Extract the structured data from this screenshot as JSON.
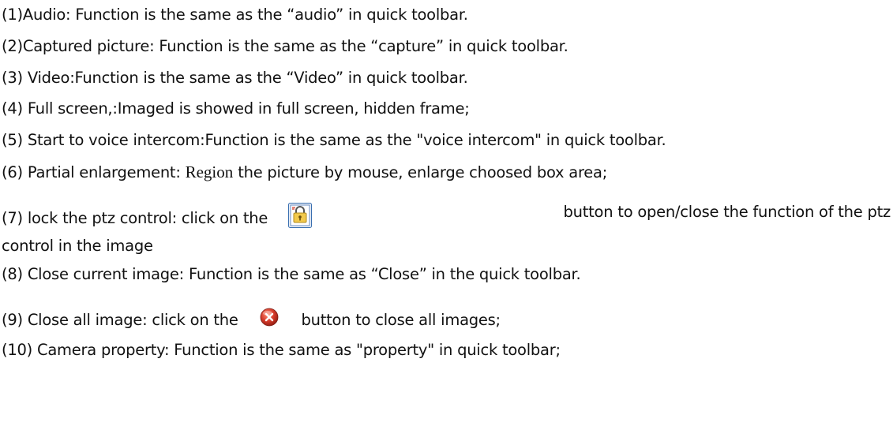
{
  "items": [
    {
      "text": "(1)Audio: Function is the same as the “audio” in quick toolbar."
    },
    {
      "text": "(2)Captured picture: Function is the same as the “capture” in quick toolbar."
    },
    {
      "text": "(3) Video:Function is the same as the “Video” in quick toolbar."
    },
    {
      "text": "(4) Full screen,:Imaged is showed in full screen, hidden frame;"
    },
    {
      "text": "(5) Start to voice intercom:Function is the same as the \"voice intercom\" in quick toolbar."
    },
    {
      "before": "(6) Partial enlargement: ",
      "serif_word": "Region",
      "after": " the picture by mouse, enlarge choosed box area;"
    },
    {
      "before": "(7) lock the ptz control: click on the",
      "after": "button to open/close the function of the ptz",
      "continuation": "control in the image",
      "icon": "lock-icon"
    },
    {
      "text": "(8) Close current image: Function is the same as “Close” in the quick toolbar."
    },
    {
      "before": "(9) Close all image: click on the",
      "after": "button to close all images;",
      "icon": "close-icon"
    },
    {
      "text": "(10) Camera property: Function is the same as \"property\" in quick toolbar;"
    }
  ],
  "colors": {
    "text": "#111111",
    "close_icon_red": "#d43a2a",
    "lock_icon_blue": "#3a6fb0",
    "lock_icon_yellow": "#f2c94c"
  }
}
